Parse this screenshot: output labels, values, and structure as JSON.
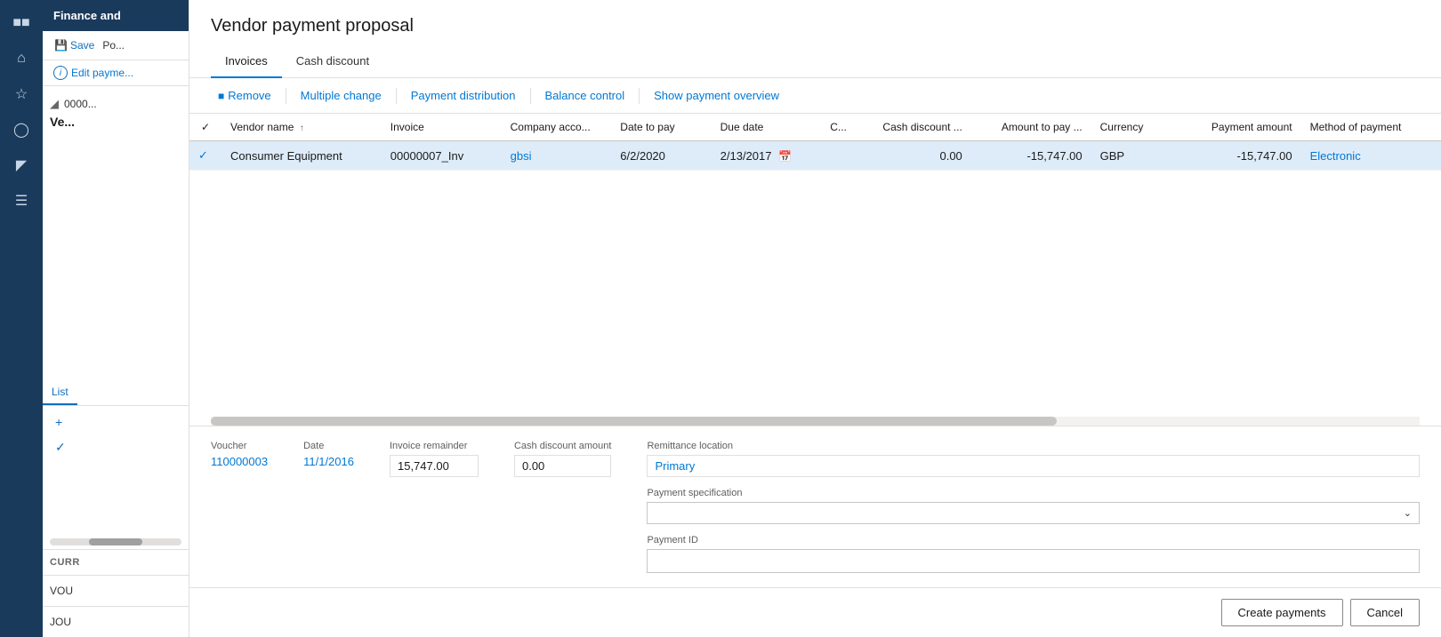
{
  "app": {
    "title": "Finance and",
    "help_label": "?"
  },
  "sidebar": {
    "icons": [
      "grid",
      "home",
      "star",
      "clock",
      "layers",
      "list"
    ]
  },
  "left_panel": {
    "header": "Finance and",
    "save_label": "Save",
    "post_label": "Po...",
    "edit_payment_label": "Edit payme...",
    "filter_icon": "⊻",
    "record_id": "0000...",
    "record_title": "Ve...",
    "tab_list": "List",
    "actions": [
      {
        "icon": "+",
        "label": "+"
      },
      {
        "icon": "✓",
        "label": "✓"
      }
    ],
    "section_curr": "CURR",
    "field_vou": "VOU",
    "field_jou": "JOU",
    "scrollbar": true
  },
  "dialog": {
    "title": "Vendor payment proposal",
    "tabs": [
      {
        "label": "Invoices",
        "active": true
      },
      {
        "label": "Cash discount",
        "active": false
      }
    ],
    "toolbar": {
      "remove_label": "Remove",
      "multiple_change_label": "Multiple change",
      "payment_distribution_label": "Payment distribution",
      "balance_control_label": "Balance control",
      "show_payment_overview_label": "Show payment overview"
    },
    "table": {
      "columns": [
        {
          "key": "check",
          "label": "",
          "numeric": false
        },
        {
          "key": "vendor_name",
          "label": "Vendor name",
          "sort": true,
          "numeric": false
        },
        {
          "key": "invoice",
          "label": "Invoice",
          "numeric": false
        },
        {
          "key": "company_acct",
          "label": "Company acco...",
          "numeric": false
        },
        {
          "key": "date_to_pay",
          "label": "Date to pay",
          "numeric": false
        },
        {
          "key": "due_date",
          "label": "Due date",
          "numeric": false
        },
        {
          "key": "c",
          "label": "C...",
          "numeric": false
        },
        {
          "key": "cash_discount",
          "label": "Cash discount ...",
          "numeric": true
        },
        {
          "key": "amount_to_pay",
          "label": "Amount to pay ...",
          "numeric": true
        },
        {
          "key": "currency",
          "label": "Currency",
          "numeric": false
        },
        {
          "key": "payment_amount",
          "label": "Payment amount",
          "numeric": true
        },
        {
          "key": "method_of_payment",
          "label": "Method of payment",
          "numeric": false
        }
      ],
      "rows": [
        {
          "check": "",
          "vendor_name": "Consumer Equipment",
          "invoice": "00000007_Inv",
          "company_acct": "gbsi",
          "date_to_pay": "6/2/2020",
          "due_date": "2/13/2017",
          "c": "",
          "cash_discount": "0.00",
          "amount_to_pay": "-15,747.00",
          "currency": "GBP",
          "payment_amount": "-15,747.00",
          "method_of_payment": "Electronic",
          "selected": true
        }
      ]
    },
    "detail": {
      "voucher_label": "Voucher",
      "voucher_value": "110000003",
      "date_label": "Date",
      "date_value": "11/1/2016",
      "invoice_remainder_label": "Invoice remainder",
      "invoice_remainder_value": "15,747.00",
      "cash_discount_amount_label": "Cash discount amount",
      "cash_discount_amount_value": "0.00",
      "remittance_location_label": "Remittance location",
      "remittance_location_value": "Primary",
      "payment_specification_label": "Payment specification",
      "payment_specification_value": "",
      "payment_id_label": "Payment ID",
      "payment_id_value": ""
    },
    "footer": {
      "create_payments_label": "Create payments",
      "cancel_label": "Cancel"
    }
  }
}
